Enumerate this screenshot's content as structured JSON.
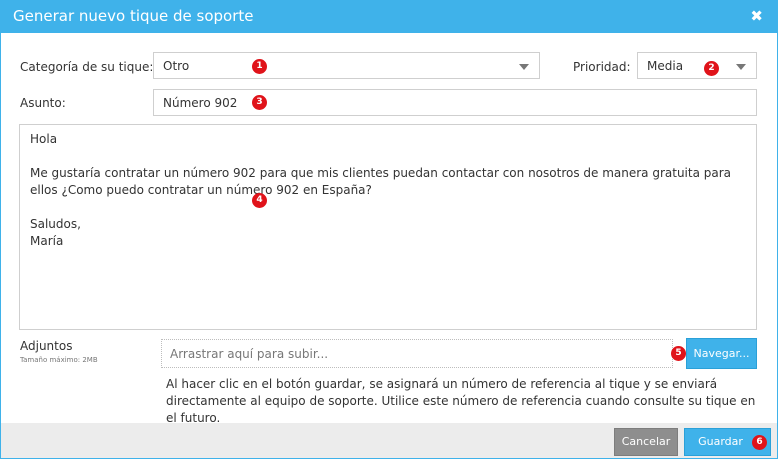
{
  "dialog": {
    "title": "Generar nuevo tique de soporte",
    "close_glyph": "✖"
  },
  "form": {
    "category_label": "Categoría de su tique:",
    "category_value": "Otro",
    "priority_label": "Prioridad:",
    "priority_value": "Media",
    "subject_label": "Asunto:",
    "subject_value": "Número 902",
    "message_lines": [
      "Hola",
      "Me gustaría contratar un número 902 para que mis clientes puedan contactar con nosotros de manera gratuita para ellos ¿Como puedo contratar un número 902 en España?",
      "Saludos,",
      "María"
    ],
    "attachments_label": "Adjuntos",
    "attachments_max": "Tamaño máximo: 2MB",
    "dropzone_placeholder": "Arrastrar aquí para subir...",
    "browse_label": "Navegar...",
    "notice": "Al hacer clic en el botón guardar, se asignará un número de referencia al tique y se enviará directamente al equipo de soporte. Utilice este número de referencia cuando consulte su tique en el futuro."
  },
  "footer": {
    "cancel_label": "Cancelar",
    "save_label": "Guardar"
  },
  "badges": [
    "1",
    "2",
    "3",
    "4",
    "5",
    "6"
  ],
  "colors": {
    "accent": "#3fb2ea",
    "badge": "#e0131a",
    "cancel": "#8e8e8e"
  }
}
